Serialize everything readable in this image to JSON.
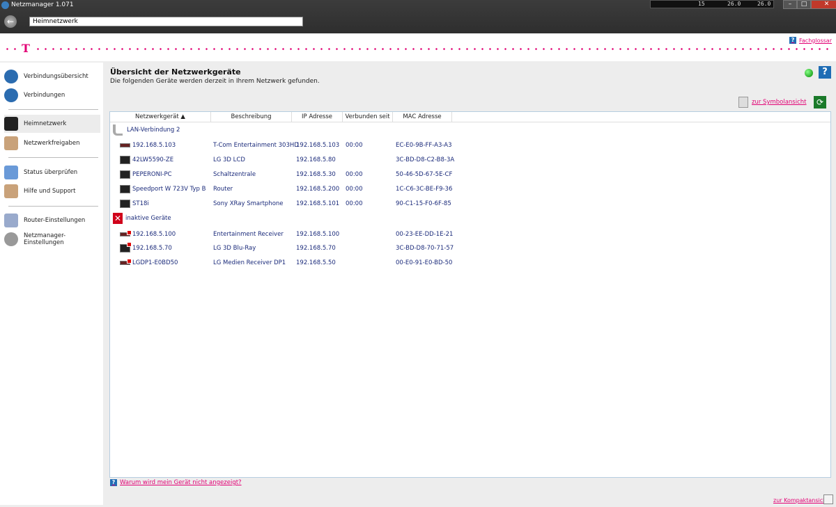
{
  "window": {
    "title": "Netzmanager 1.071",
    "address": "Heimnetzwerk",
    "tray": {
      "num": "15",
      "temp1": "26.0",
      "temp2": "26.0"
    }
  },
  "header": {
    "glossar": "Fachglossar",
    "logo": "T"
  },
  "sidebar": {
    "items": [
      {
        "label": "Verbindungsübersicht",
        "icon": "globe-icon"
      },
      {
        "label": "Verbindungen",
        "icon": "globe-network-icon"
      },
      {
        "label": "Heimnetzwerk",
        "icon": "home-network-icon",
        "selected": true
      },
      {
        "label": "Netzwerkfreigaben",
        "icon": "network-share-icon"
      },
      {
        "label": "Status überprüfen",
        "icon": "status-check-icon"
      },
      {
        "label": "Hilfe und Support",
        "icon": "help-support-icon"
      },
      {
        "label": "Router-Einstellungen",
        "icon": "router-settings-icon"
      },
      {
        "label": "Netzmanager-Einstellungen",
        "icon": "gear-icon"
      }
    ]
  },
  "main": {
    "title": "Übersicht der Netzwerkgeräte",
    "subtitle": "Die folgenden Geräte werden derzeit in Ihrem Netzwerk gefunden.",
    "symbol_view": "zur Symbolansicht",
    "why_link": "Warum wird mein Gerät nicht angezeigt?",
    "compact_view": "zur Kompaktansicht",
    "status_color": "#1a9a1a"
  },
  "table": {
    "columns": [
      "Netzwerkgerät ▲",
      "Beschreibung",
      "IP Adresse",
      "Verbunden seit",
      "MAC Adresse"
    ],
    "groups": [
      {
        "name": "LAN-Verbindung 2",
        "rows": [
          [
            "192.168.5.103",
            "T-Com Entertainment 303HD",
            "192.168.5.103",
            "00:00",
            "EC-E0-9B-FF-A3-A3"
          ],
          [
            "42LW5590-ZE",
            "LG 3D LCD",
            "192.168.5.80",
            "",
            "3C-BD-D8-C2-B8-3A"
          ],
          [
            "PEPERONI-PC",
            "Schaltzentrale",
            "192.168.5.30",
            "00:00",
            "50-46-5D-67-5E-CF"
          ],
          [
            "Speedport W 723V Typ B",
            "Router",
            "192.168.5.200",
            "00:00",
            "1C-C6-3C-BE-F9-36"
          ],
          [
            "ST18i",
            "Sony XRay Smartphone",
            "192.168.5.101",
            "00:00",
            "90-C1-15-F0-6F-85"
          ]
        ]
      },
      {
        "name": "inaktive Geräte",
        "rows": [
          [
            "192.168.5.100",
            "Entertainment Receiver",
            "192.168.5.100",
            "",
            "00-23-EE-DD-1E-21"
          ],
          [
            "192.168.5.70",
            "LG 3D Blu-Ray",
            "192.168.5.70",
            "",
            "3C-BD-D8-70-71-57"
          ],
          [
            "LGDP1-E0BD50",
            "LG Medien Receiver DP1",
            "192.168.5.50",
            "",
            "00-E0-91-E0-BD-50"
          ]
        ]
      }
    ]
  }
}
